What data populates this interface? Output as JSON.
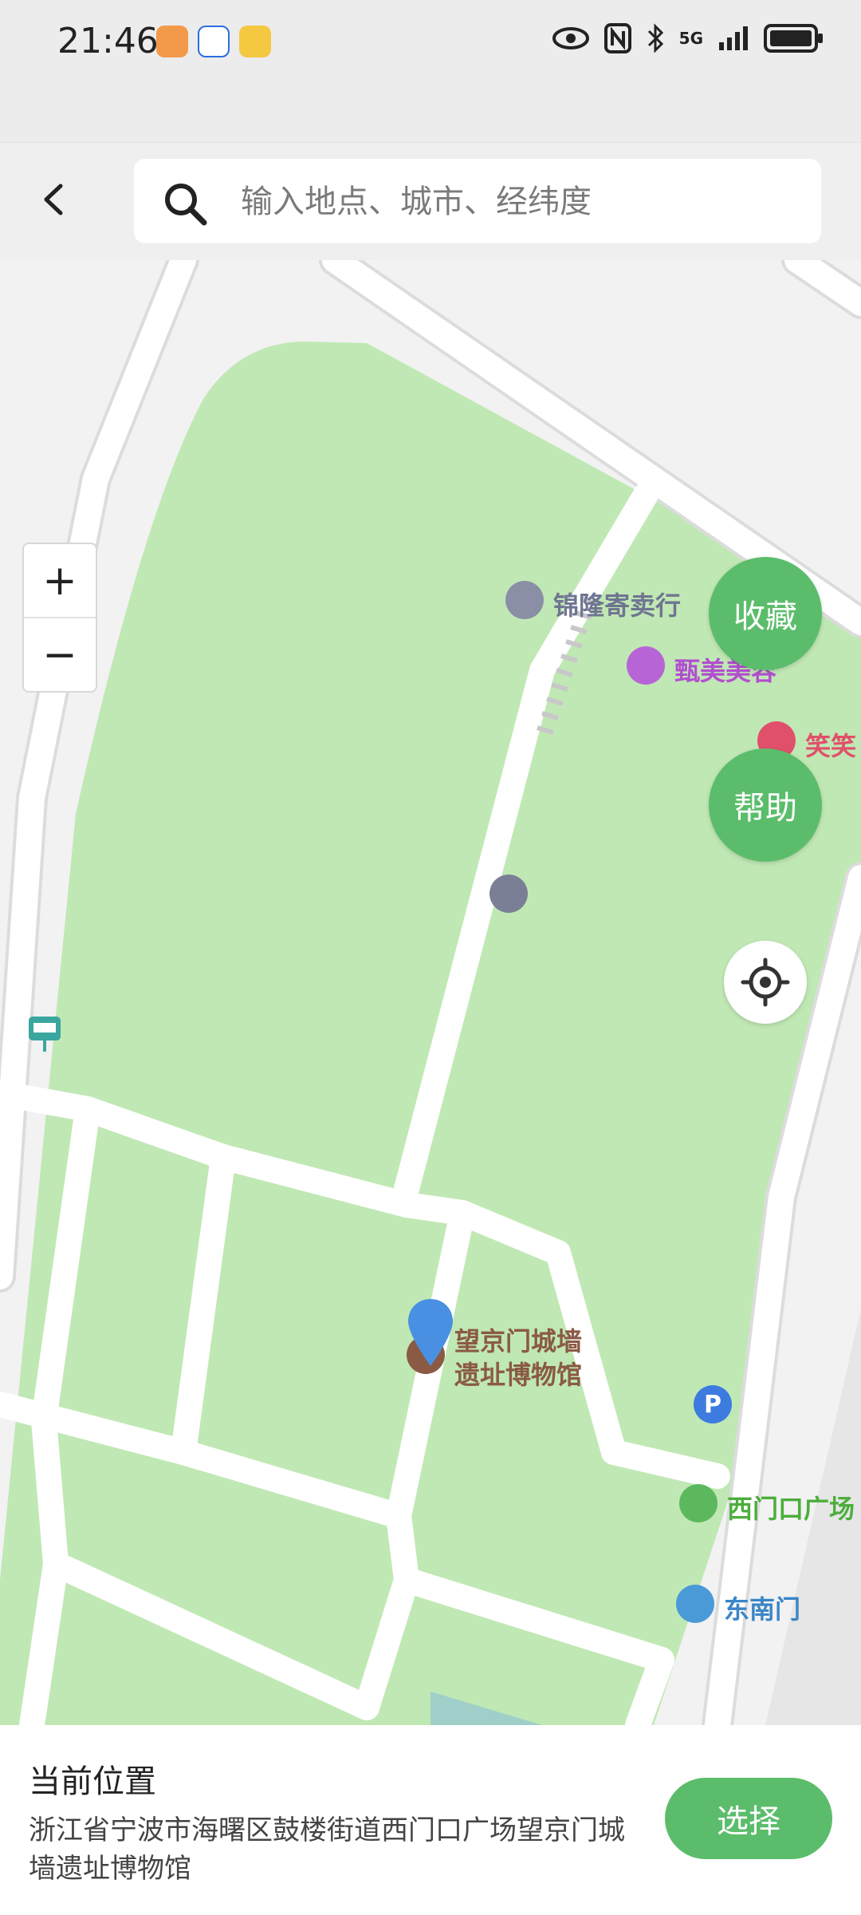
{
  "status_bar": {
    "time": "21:46",
    "network": "5G"
  },
  "header": {
    "search_placeholder": "输入地点、城市、经纬度"
  },
  "map": {
    "zoom_in": "+",
    "zoom_out": "−",
    "favorite_button": "收藏",
    "help_button": "帮助",
    "pois": {
      "consignment": "锦隆寄卖行",
      "beauty": "甄美美容",
      "smile": "笑笑",
      "museum_line1": "望京门城墙",
      "museum_line2": "遗址博物馆",
      "parking": "P",
      "plaza": "西门口广场",
      "gate": "东南门",
      "bus_b": "B"
    }
  },
  "bottom_panel": {
    "title": "当前位置",
    "address": "浙江省宁波市海曙区鼓楼街道西门口广场望京门城墙遗址博物馆",
    "select_button": "选择"
  },
  "colors": {
    "accent": "#5bbd6b",
    "park": "#c0e8b4",
    "road": "#ffffff",
    "pin": "#4a90e2"
  }
}
